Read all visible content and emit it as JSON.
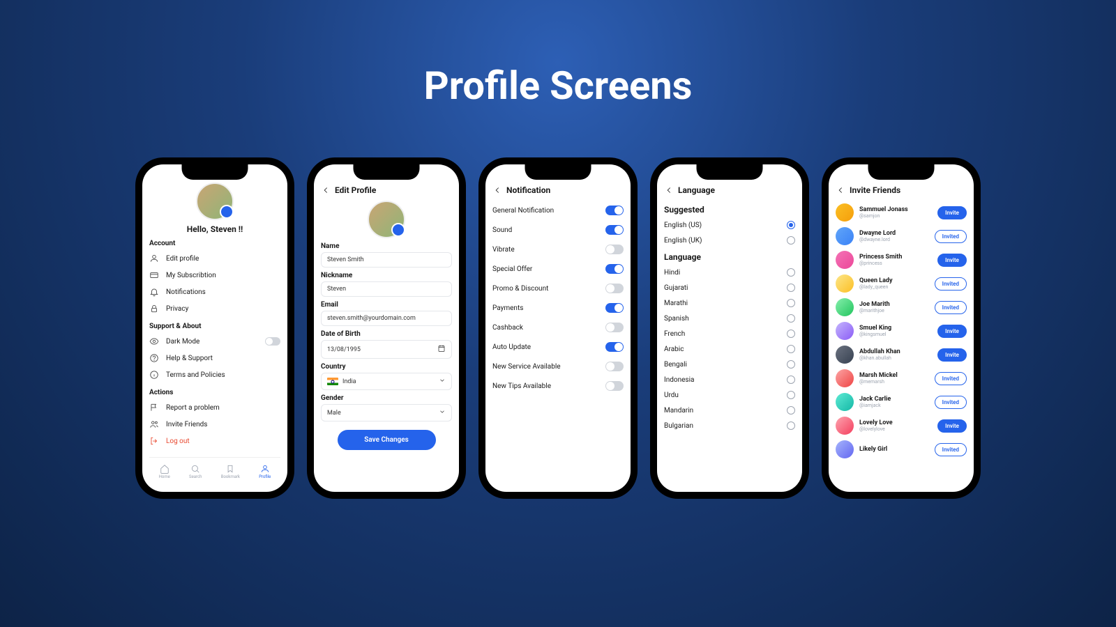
{
  "title": "Profile Screens",
  "profile": {
    "greeting": "Hello, Steven !!",
    "sections": {
      "account": {
        "label": "Account",
        "items": [
          "Edit profile",
          "My Subscribtion",
          "Notifications",
          "Privacy"
        ]
      },
      "support": {
        "label": "Support & About",
        "items": [
          "Dark Mode",
          "Help & Support",
          "Terms and Policies"
        ]
      },
      "actions": {
        "label": "Actions",
        "items": [
          "Report a problem",
          "Invite Friends",
          "Log out"
        ]
      }
    },
    "nav": [
      "Home",
      "Search",
      "Bookmark",
      "Profile"
    ]
  },
  "edit": {
    "title": "Edit Profile",
    "fields": {
      "name": {
        "label": "Name",
        "value": "Steven Smith"
      },
      "nickname": {
        "label": "Nickname",
        "value": "Steven"
      },
      "email": {
        "label": "Email",
        "value": "steven.smith@yourdomain.com"
      },
      "dob": {
        "label": "Date of Birth",
        "value": "13/08/1995"
      },
      "country": {
        "label": "Country",
        "value": "India"
      },
      "gender": {
        "label": "Gender",
        "value": "Male"
      }
    },
    "save": "Save Changes"
  },
  "notif": {
    "title": "Notification",
    "items": [
      {
        "label": "General Notification",
        "on": true
      },
      {
        "label": "Sound",
        "on": true
      },
      {
        "label": "Vibrate",
        "on": false
      },
      {
        "label": "Special Offer",
        "on": true
      },
      {
        "label": "Promo & Discount",
        "on": false
      },
      {
        "label": "Payments",
        "on": true
      },
      {
        "label": "Cashback",
        "on": false
      },
      {
        "label": "Auto Update",
        "on": true
      },
      {
        "label": "New Service Available",
        "on": false
      },
      {
        "label": "New Tips Available",
        "on": false
      }
    ]
  },
  "lang": {
    "title": "Language",
    "suggested_label": "Suggested",
    "suggested": [
      {
        "name": "English (US)",
        "sel": true
      },
      {
        "name": "English (UK)",
        "sel": false
      }
    ],
    "language_label": "Language",
    "list": [
      "Hindi",
      "Gujarati",
      "Marathi",
      "Spanish",
      "French",
      "Arabic",
      "Bengali",
      "Indonesia",
      "Urdu",
      "Mandarin",
      "Bulgarian"
    ]
  },
  "invite": {
    "title": "Invite Friends",
    "btn_invite": "Invite",
    "btn_invited": "Invited",
    "friends": [
      {
        "name": "Sammuel Jonass",
        "handle": "@samjon",
        "invited": false
      },
      {
        "name": "Dwayne Lord",
        "handle": "@dwayne.lord",
        "invited": true
      },
      {
        "name": "Princess Smith",
        "handle": "@princess",
        "invited": false
      },
      {
        "name": "Queen Lady",
        "handle": "@lady_queen",
        "invited": true
      },
      {
        "name": "Joe Marith",
        "handle": "@marithjoe",
        "invited": true
      },
      {
        "name": "Smuel King",
        "handle": "@kingsmuel",
        "invited": false
      },
      {
        "name": "Abdullah Khan",
        "handle": "@khan.abullah",
        "invited": false
      },
      {
        "name": "Marsh Mickel",
        "handle": "@memarsh",
        "invited": true
      },
      {
        "name": "Jack Carlie",
        "handle": "@iamjack",
        "invited": true
      },
      {
        "name": "Lovely Love",
        "handle": "@lovelylove",
        "invited": false
      },
      {
        "name": "Likely Girl",
        "handle": "",
        "invited": true
      }
    ]
  }
}
